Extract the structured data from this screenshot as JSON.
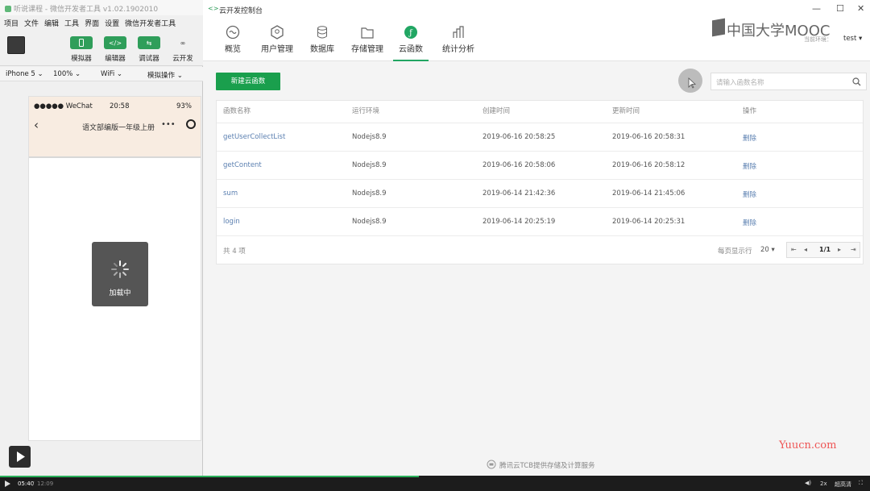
{
  "devtools": {
    "title": "听说课程 - 微信开发者工具 v1.02.1902010",
    "menu": [
      "项目",
      "文件",
      "编辑",
      "工具",
      "界面",
      "设置",
      "微信开发者工具"
    ],
    "toolbar": [
      {
        "label": "模拟器",
        "icon": "phone-icon",
        "active": true
      },
      {
        "label": "编辑器",
        "icon": "code-icon",
        "active": true
      },
      {
        "label": "调试器",
        "icon": "debug-icon",
        "active": true
      },
      {
        "label": "云开发",
        "icon": "cloud-icon",
        "active": false
      }
    ],
    "device_bar": {
      "device": "iPhone 5 ⌄",
      "zoom": "100% ⌄",
      "network": "WiFi ⌄",
      "mode": "模拟操作 ⌄"
    },
    "simulator": {
      "status_left": "●●●●● WeChat",
      "status_time": "20:58",
      "status_battery": "93%",
      "nav_title": "语文部编版一年级上册",
      "loading_text": "加载中"
    }
  },
  "console": {
    "title": "云开发控制台",
    "brand": "中国大学MOOC",
    "env_label": "当前环境：",
    "env_value": "test ▾",
    "tabs": [
      {
        "label": "概览",
        "icon": "overview-icon"
      },
      {
        "label": "用户管理",
        "icon": "user-manage-icon"
      },
      {
        "label": "数据库",
        "icon": "database-icon"
      },
      {
        "label": "存储管理",
        "icon": "storage-icon"
      },
      {
        "label": "云函数",
        "icon": "cloud-function-icon",
        "active": true
      },
      {
        "label": "统计分析",
        "icon": "stats-icon"
      }
    ],
    "new_button": "新建云函数",
    "search_placeholder": "请输入函数名称",
    "table": {
      "headers": [
        "函数名称",
        "运行环境",
        "创建时间",
        "更新时间",
        "操作"
      ],
      "rows": [
        [
          "getUserCollectList",
          "Nodejs8.9",
          "2019-06-16 20:58:25",
          "2019-06-16 20:58:31",
          "删除"
        ],
        [
          "getContent",
          "Nodejs8.9",
          "2019-06-16 20:58:06",
          "2019-06-16 20:58:12",
          "删除"
        ],
        [
          "sum",
          "Nodejs8.9",
          "2019-06-14 21:42:36",
          "2019-06-14 21:45:06",
          "删除"
        ],
        [
          "login",
          "Nodejs8.9",
          "2019-06-14 20:25:19",
          "2019-06-14 20:25:31",
          "删除"
        ]
      ],
      "total": "共 4 项",
      "per_page_label": "每页显示行",
      "per_page_value": "20 ▾",
      "page": "1/1"
    },
    "footer": "腾讯云TCB提供存储及计算服务"
  },
  "watermark": "Yuucn.com",
  "player": {
    "current": "05:40",
    "total": "12:09",
    "speed": "2x",
    "quality": "超高清"
  },
  "colors": {
    "accent": "#1a9f4d",
    "link": "#5a7fb0"
  }
}
